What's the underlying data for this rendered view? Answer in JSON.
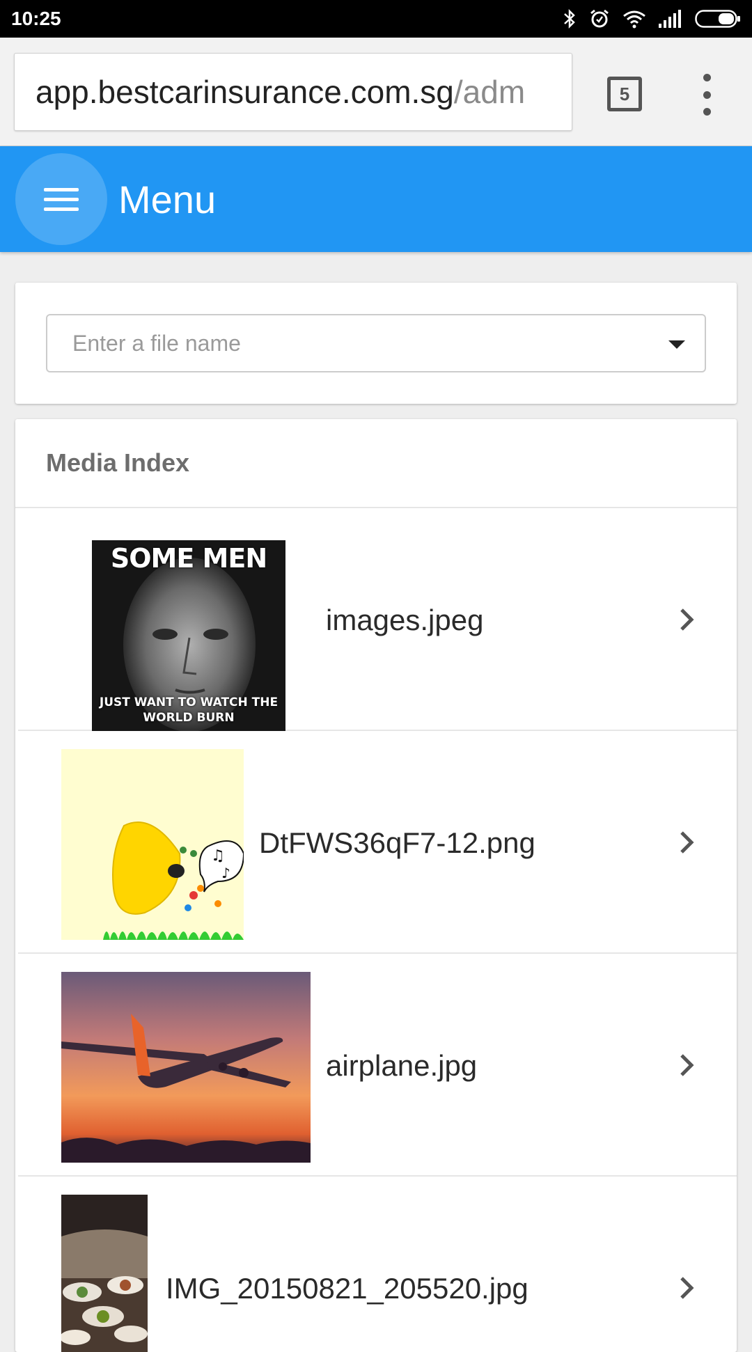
{
  "status_bar": {
    "time": "10:25",
    "icons": [
      "bluetooth-icon",
      "alarm-icon",
      "wifi-icon",
      "signal-icon",
      "battery-icon"
    ]
  },
  "browser": {
    "url_host": "app.bestcarinsurance.com.sg",
    "url_path": "/adm",
    "tab_count": "5"
  },
  "app_bar": {
    "title": "Menu",
    "color": "#2196f3"
  },
  "search": {
    "placeholder": "Enter a file name",
    "value": ""
  },
  "media": {
    "title": "Media Index",
    "items": [
      {
        "name": "images.jpeg",
        "thumb_caption_top": "SOME MEN",
        "thumb_caption_bottom": "JUST WANT TO WATCH THE WORLD BURN"
      },
      {
        "name": "DtFWS36qF7-12.png"
      },
      {
        "name": "airplane.jpg"
      },
      {
        "name": "IMG_20150821_205520.jpg"
      }
    ]
  }
}
